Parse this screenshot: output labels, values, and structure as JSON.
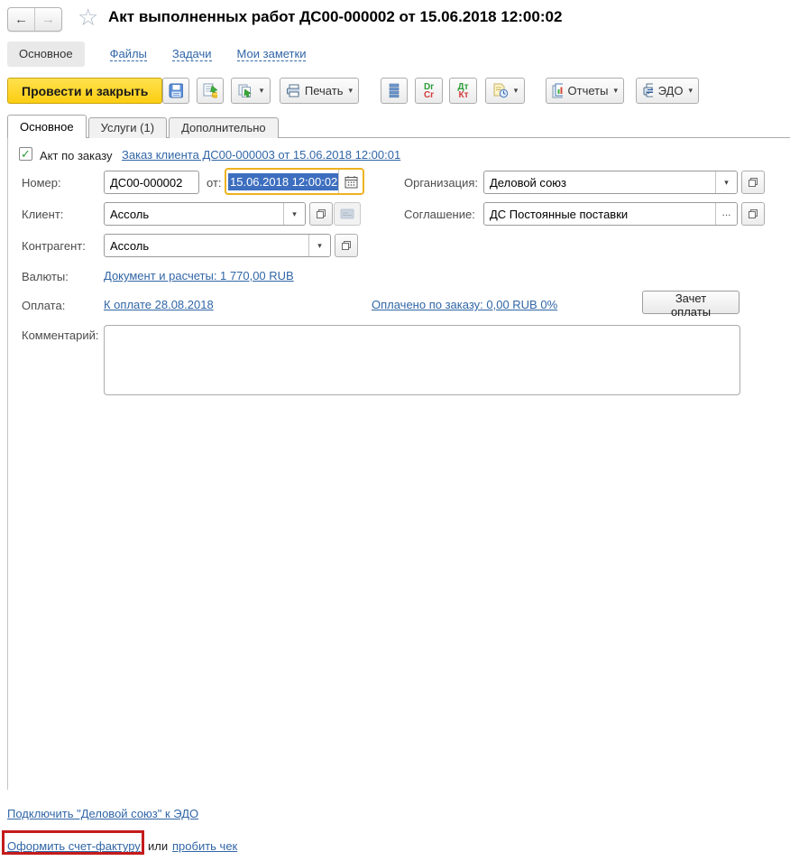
{
  "header": {
    "title": "Акт выполненных работ ДС00-000002 от 15.06.2018 12:00:02"
  },
  "icons": {
    "back": "←",
    "forward": "→",
    "star": "☆",
    "dropdown": "▾",
    "ellipsis": "...",
    "check": "✓"
  },
  "nav": {
    "items": [
      {
        "label": "Основное"
      },
      {
        "label": "Файлы"
      },
      {
        "label": "Задачи"
      },
      {
        "label": "Мои заметки"
      }
    ]
  },
  "toolbar": {
    "post_and_close": "Провести и закрыть",
    "print": "Печать",
    "reports": "Отчеты",
    "edo": "ЭДО",
    "drcr": {
      "top": "Dr",
      "bottom": "Cr"
    },
    "dtkt": {
      "top": "Дт",
      "bottom": "Кт"
    }
  },
  "tabs": [
    {
      "label": "Основное"
    },
    {
      "label": "Услуги (1)"
    },
    {
      "label": "Дополнительно"
    }
  ],
  "form": {
    "order_flag_label": "Акт по заказу",
    "order_link": "Заказ клиента ДС00-000003 от 15.06.2018 12:00:01",
    "number": {
      "label": "Номер:",
      "value": "ДС00-000002"
    },
    "date": {
      "label": "от:",
      "value": "15.06.2018 12:00:02"
    },
    "organization": {
      "label": "Организация:",
      "value": "Деловой союз"
    },
    "client": {
      "label": "Клиент:",
      "value": "Ассоль"
    },
    "agreement": {
      "label": "Соглашение:",
      "value": "ДС Постоянные поставки"
    },
    "counterparty": {
      "label": "Контрагент:",
      "value": "Ассоль"
    },
    "currencies": {
      "label": "Валюты:",
      "link": "Документ и расчеты: 1 770,00 RUB"
    },
    "payment": {
      "label": "Оплата:",
      "due_link": "К оплате 28.08.2018",
      "paid_link": "Оплачено по заказу: 0,00 RUB  0%",
      "offset_button": "Зачет оплаты"
    },
    "comment": {
      "label": "Комментарий:",
      "value": ""
    }
  },
  "footer": {
    "edo_connect_link": "Подключить \"Деловой союз\" к ЭДО",
    "invoice_link": "Оформить счет-фактуру",
    "or_text": "или",
    "receipt_link": "пробить чек"
  },
  "colors": {
    "primary_button": "#FCCE12",
    "focus_border": "#EEB220",
    "selection_bg": "#3D6EBF",
    "link": "#3166A6",
    "annotation": "#C41B1B"
  }
}
